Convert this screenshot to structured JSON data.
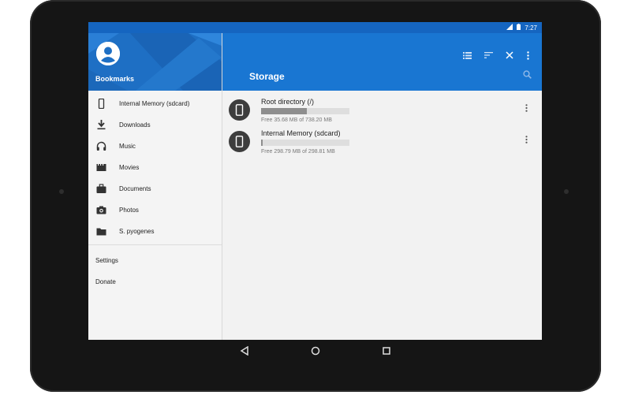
{
  "status": {
    "time": "7:27"
  },
  "drawer": {
    "title": "Bookmarks",
    "items": [
      {
        "label": "Internal Memory (sdcard)",
        "icon": "phone-icon"
      },
      {
        "label": "Downloads",
        "icon": "download-icon"
      },
      {
        "label": "Music",
        "icon": "headphones-icon"
      },
      {
        "label": "Movies",
        "icon": "movie-icon"
      },
      {
        "label": "Documents",
        "icon": "briefcase-icon"
      },
      {
        "label": "Photos",
        "icon": "camera-icon"
      },
      {
        "label": "S. pyogenes",
        "icon": "folder-icon"
      }
    ],
    "settings": "Settings",
    "donate": "Donate"
  },
  "toolbar": {
    "title": "Storage"
  },
  "storage": [
    {
      "name": "Root directory (/)",
      "usage": "Free 35.68 MB of 738.20 MB",
      "used_fraction": 0.52
    },
    {
      "name": "Internal Memory (sdcard)",
      "usage": "Free 298.79 MB of 298.81 MB",
      "used_fraction": 0.02
    }
  ],
  "colors": {
    "primary": "#1976d2",
    "primary_dark": "#1565c0",
    "drawer_bg": "#f4f4f4",
    "content_bg": "#f2f2f2"
  }
}
